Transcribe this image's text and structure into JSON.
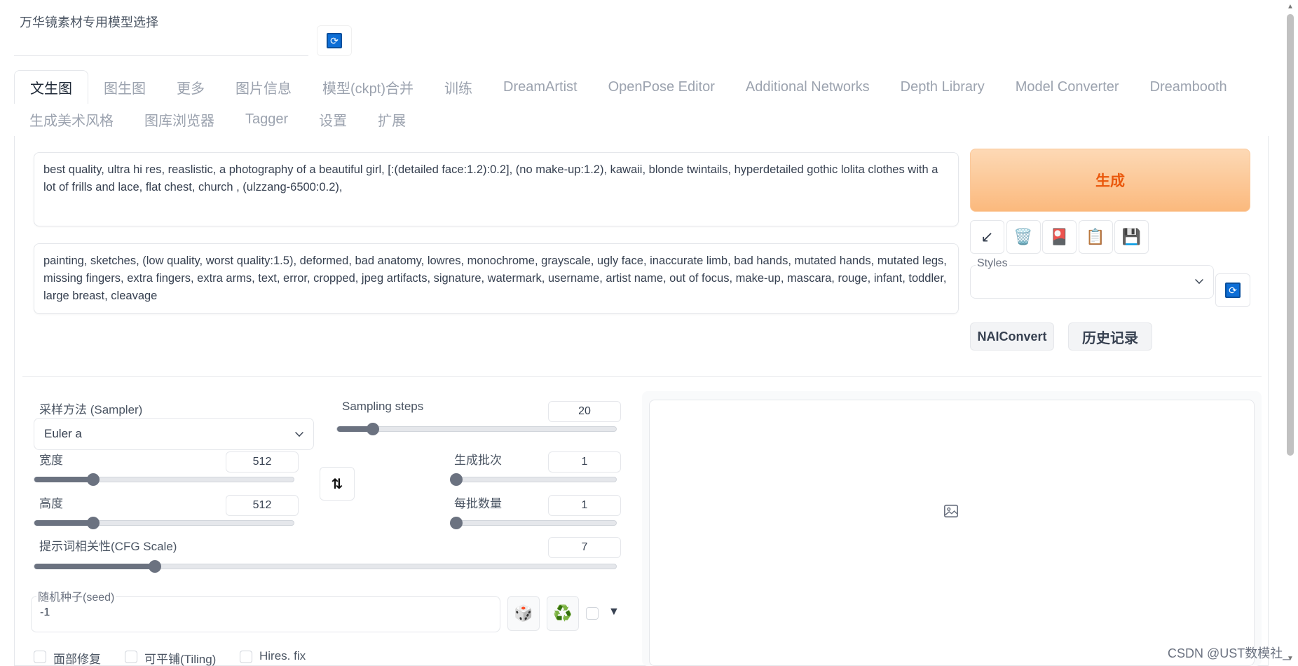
{
  "model_selector": {
    "label": "万华镜素材专用模型选择",
    "value": ""
  },
  "tabs_row1": [
    "文生图",
    "图生图",
    "更多",
    "图片信息",
    "模型(ckpt)合并",
    "训练",
    "DreamArtist",
    "OpenPose Editor",
    "Additional Networks",
    "Depth Library",
    "Model Converter",
    "Dreambooth"
  ],
  "tabs_row2": [
    "生成美术风格",
    "图库浏览器",
    "Tagger",
    "设置",
    "扩展"
  ],
  "active_tab": "文生图",
  "prompt": "best quality, ultra hi res, reaslistic, a photography of a beautiful girl, [:(detailed face:1.2):0.2], (no make-up:1.2), kawaii, blonde twintails, hyperdetailed gothic lolita clothes with a lot of frills and lace, flat chest, church , (ulzzang-6500:0.2),",
  "negative_prompt": "painting, sketches, (low quality, worst quality:1.5), deformed, bad anatomy, lowres, monochrome, grayscale, ugly face, inaccurate limb, bad hands, mutated hands, mutated legs, missing fingers, extra fingers, extra arms, text, error, cropped, jpeg artifacts, signature, watermark, username, artist name, out of focus, make-up, mascara, rouge, infant, toddler, large breast, cleavage",
  "generate_label": "生成",
  "tool_buttons": [
    "↙",
    "🗑️",
    "🎴",
    "📋",
    "💾"
  ],
  "styles": {
    "label": "Styles",
    "value": ""
  },
  "nai_convert_label": "NAIConvert",
  "history_label": "历史记录",
  "sampler": {
    "label": "采样方法 (Sampler)",
    "value": "Euler a"
  },
  "sampling_steps": {
    "label": "Sampling steps",
    "value": "20",
    "min": 1,
    "max": 150,
    "current": 20
  },
  "width": {
    "label": "宽度",
    "value": "512",
    "min": 64,
    "max": 2048,
    "current": 512
  },
  "height": {
    "label": "高度",
    "value": "512",
    "min": 64,
    "max": 2048,
    "current": 512
  },
  "batch_count": {
    "label": "生成批次",
    "value": "1",
    "min": 1,
    "max": 100,
    "current": 1
  },
  "batch_size": {
    "label": "每批数量",
    "value": "1",
    "min": 1,
    "max": 8,
    "current": 1
  },
  "cfg_scale": {
    "label": "提示词相关性(CFG Scale)",
    "value": "7",
    "min": 1,
    "max": 30,
    "current": 7
  },
  "seed": {
    "label": "随机种子(seed)",
    "value": "-1"
  },
  "swap_icon": "⇅",
  "dice_icon": "🎲",
  "recycle_icon": "♻️",
  "expand_arrow": "▼",
  "checkboxes": [
    "面部修复",
    "可平铺(Tiling)",
    "Hires. fix"
  ],
  "watermark": "CSDN @UST数模社_",
  "colors": {
    "accent": "#ea580c",
    "generate_bg": "#fbb97d",
    "slider": "#6b7280",
    "refresh_blue": "#0d6ed6"
  }
}
